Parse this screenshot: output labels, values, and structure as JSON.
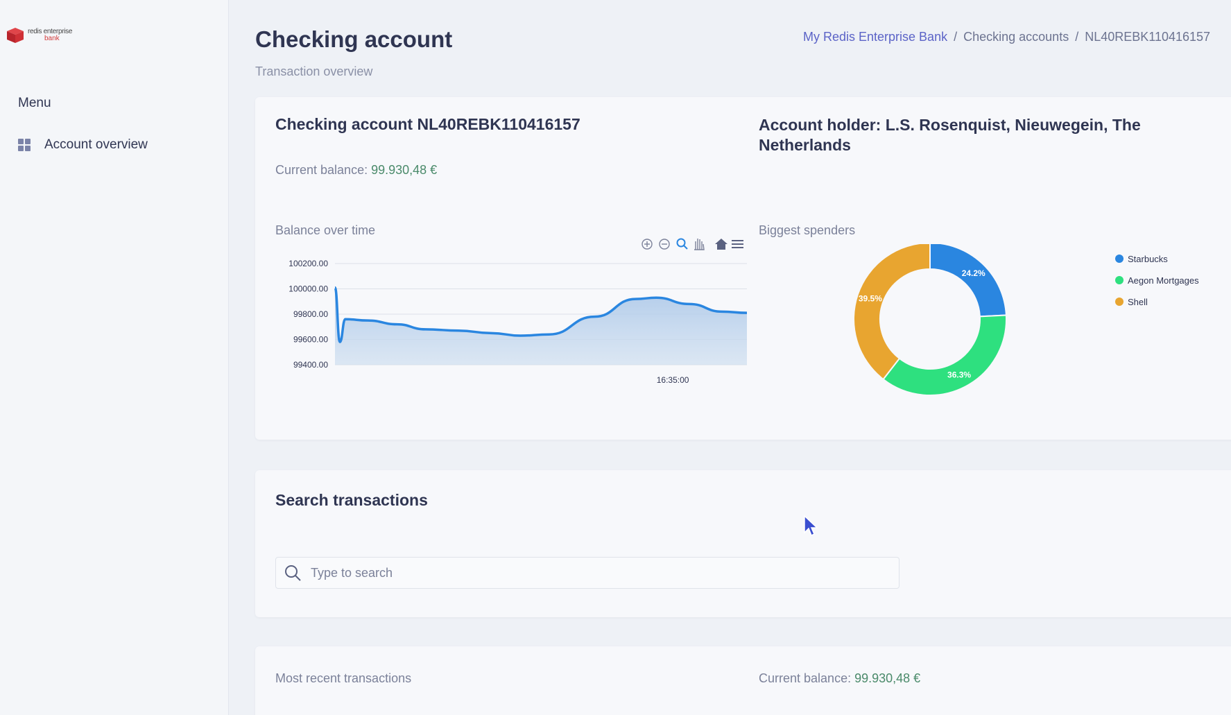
{
  "logo": {
    "line1": "redis enterprise",
    "line2": "bank"
  },
  "sidebar": {
    "menu_label": "Menu",
    "items": [
      {
        "label": "Account overview",
        "icon": "grid-icon"
      }
    ]
  },
  "header": {
    "title": "Checking account",
    "subtitle": "Transaction overview",
    "breadcrumb": [
      "My Redis Enterprise Bank",
      "Checking accounts",
      "NL40REBK110416157"
    ]
  },
  "account": {
    "title": "Checking account NL40REBK110416157",
    "holder": "Account holder: L.S. Rosenquist, Nieuwegein, The Netherlands",
    "balance_label": "Current balance:",
    "balance_value": "99.930,48 €"
  },
  "balance_chart": {
    "label": "Balance over time",
    "toolbar": [
      "zoom-in-icon",
      "zoom-out-icon",
      "magnifier-icon",
      "pan-hand-icon",
      "home-icon",
      "menu-icon"
    ]
  },
  "spenders_chart": {
    "label": "Biggest spenders"
  },
  "chart_data": [
    {
      "type": "area",
      "title": "Balance over time",
      "y_ticks": [
        "100200.00",
        "100000.00",
        "99800.00",
        "99600.00",
        "99400.00"
      ],
      "ylim": [
        99400,
        100200
      ],
      "x_tick": "16:35:00",
      "series": [
        {
          "values": [
            100010,
            99580,
            99760,
            99750,
            99720,
            99680,
            99670,
            99650,
            99630,
            99640,
            99780,
            99920,
            99930,
            99880,
            99820,
            99810
          ],
          "color": "#2a86e0"
        }
      ],
      "grid": true
    },
    {
      "type": "pie",
      "title": "Biggest spenders",
      "donut": true,
      "legend_position": "right",
      "slices": [
        {
          "label": "Starbucks",
          "value": 24.2,
          "display": "24.2%",
          "color": "#2a86e0"
        },
        {
          "label": "Aegon Mortgages",
          "value": 36.3,
          "display": "36.3%",
          "color": "#2ee07f"
        },
        {
          "label": "Shell",
          "value": 39.5,
          "display": "39.5%",
          "color": "#e8a530"
        }
      ]
    }
  ],
  "search": {
    "title": "Search transactions",
    "placeholder": "Type to search",
    "value": ""
  },
  "recent": {
    "label": "Most recent transactions",
    "balance_label": "Current balance:",
    "balance_value": "99.930,48 €"
  }
}
